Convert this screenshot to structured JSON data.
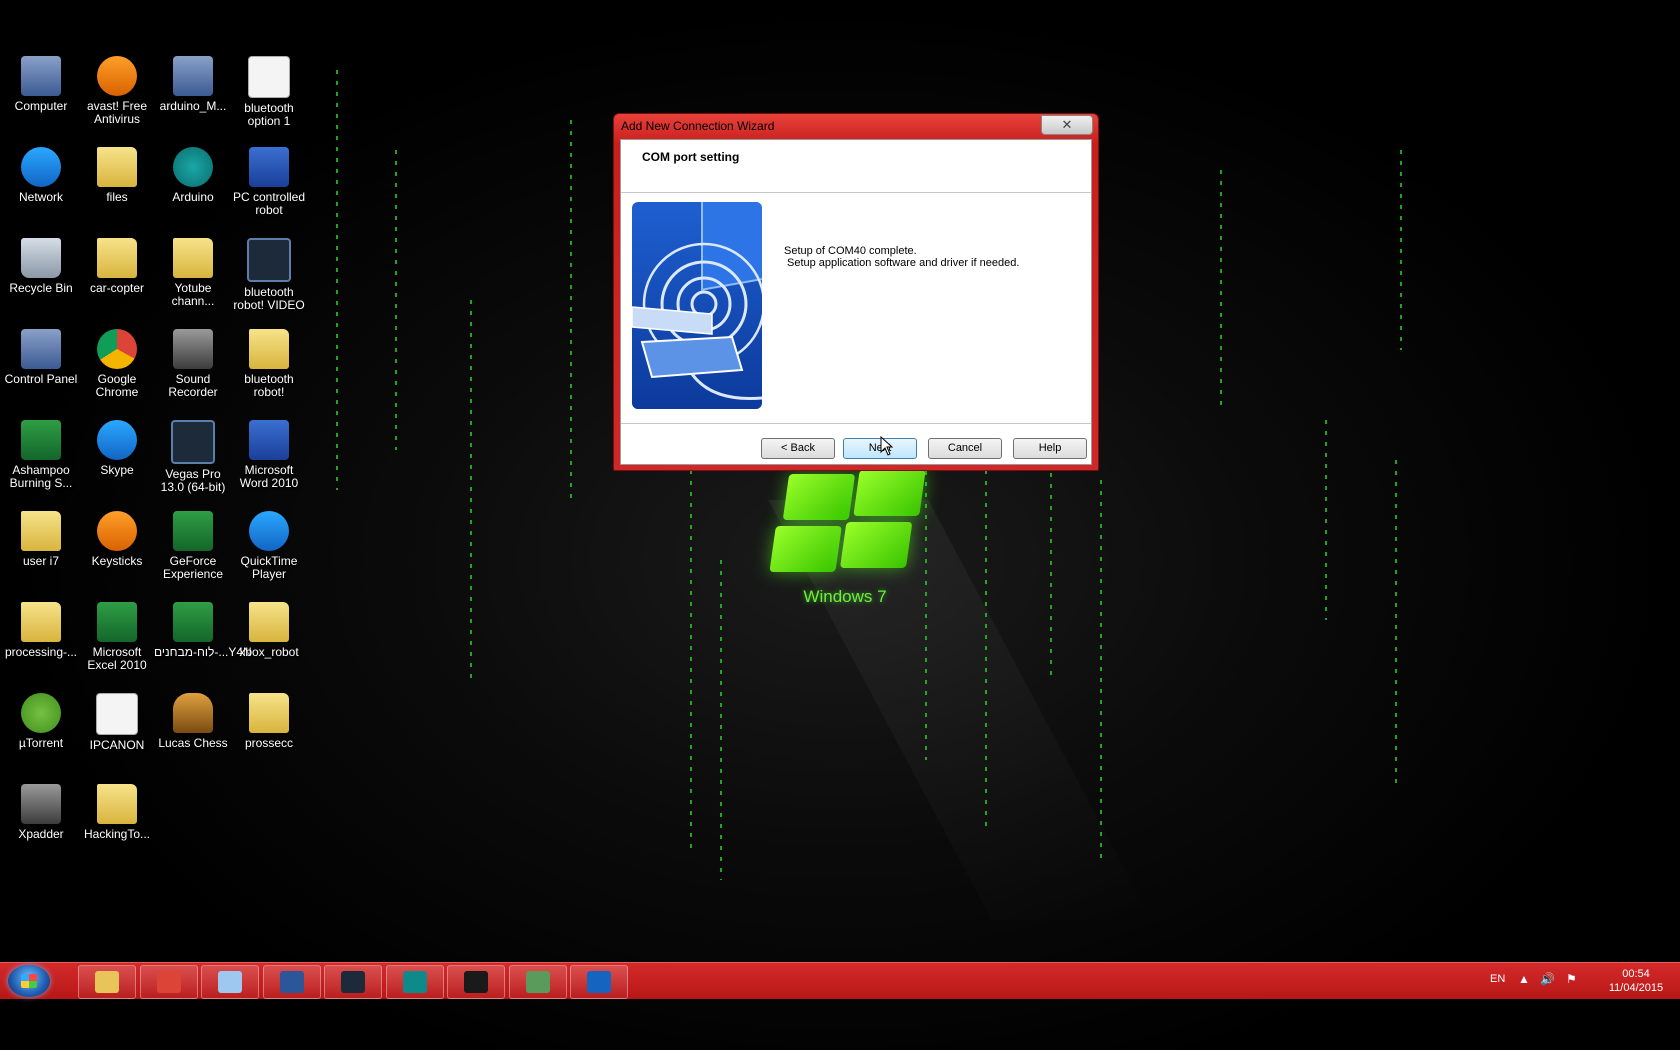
{
  "desktop": {
    "logo_text": "Windows 7",
    "icons": [
      {
        "label": "Computer",
        "icon": "computer-icon",
        "type": "exe"
      },
      {
        "label": "avast! Free Antivirus",
        "icon": "avast-icon",
        "type": "orange"
      },
      {
        "label": "arduino_M...",
        "icon": "winrar-archive-icon",
        "type": "exe"
      },
      {
        "label": "bluetooth option 1",
        "icon": "document-icon",
        "type": "doc"
      },
      {
        "label": "Network",
        "icon": "network-icon",
        "type": "blue"
      },
      {
        "label": "files",
        "icon": "folder-icon",
        "type": "folder"
      },
      {
        "label": "Arduino",
        "icon": "arduino-icon",
        "type": "green"
      },
      {
        "label": "PC controlled robot",
        "icon": "word-document-icon",
        "type": "word"
      },
      {
        "label": "Recycle Bin",
        "icon": "recycle-bin-icon",
        "type": "bin"
      },
      {
        "label": "car-copter",
        "icon": "folder-icon",
        "type": "folder"
      },
      {
        "label": "Yotube chann...",
        "icon": "folder-icon",
        "type": "folder"
      },
      {
        "label": "bluetooth robot! VIDEO",
        "icon": "video-file-icon",
        "type": "video"
      },
      {
        "label": "Control Panel",
        "icon": "control-panel-icon",
        "type": "exe"
      },
      {
        "label": "Google Chrome",
        "icon": "chrome-icon",
        "type": "chrome"
      },
      {
        "label": "Sound Recorder",
        "icon": "microphone-icon",
        "type": "gray"
      },
      {
        "label": "bluetooth robot!",
        "icon": "folder-icon",
        "type": "folder"
      },
      {
        "label": "Ashampoo Burning S...",
        "icon": "ashampoo-icon",
        "type": "excel"
      },
      {
        "label": "Skype",
        "icon": "skype-icon",
        "type": "blue"
      },
      {
        "label": "Vegas Pro 13.0 (64-bit)",
        "icon": "vegas-pro-icon",
        "type": "video"
      },
      {
        "label": "Microsoft Word 2010",
        "icon": "word-icon",
        "type": "word"
      },
      {
        "label": "user i7",
        "icon": "user-folder-icon",
        "type": "folder"
      },
      {
        "label": "Keysticks",
        "icon": "keysticks-icon",
        "type": "orange"
      },
      {
        "label": "GeForce Experience",
        "icon": "geforce-icon",
        "type": "excel"
      },
      {
        "label": "QuickTime Player",
        "icon": "quicktime-icon",
        "type": "blue"
      },
      {
        "label": "processing-...",
        "icon": "folder-icon",
        "type": "folder"
      },
      {
        "label": "Microsoft Excel 2010",
        "icon": "excel-icon",
        "type": "excel"
      },
      {
        "label": "לוח-מבחנים-...Y4N",
        "icon": "excel-document-icon",
        "type": "excel"
      },
      {
        "label": "xbox_robot",
        "icon": "folder-icon",
        "type": "folder"
      },
      {
        "label": "µTorrent",
        "icon": "utorrent-icon",
        "type": "utorrent"
      },
      {
        "label": "IPCANON",
        "icon": "text-file-icon",
        "type": "doc"
      },
      {
        "label": "Lucas Chess",
        "icon": "chess-pawn-icon",
        "type": "chess"
      },
      {
        "label": "prossecc",
        "icon": "folder-icon",
        "type": "folder"
      },
      {
        "label": "Xpadder",
        "icon": "gamepad-icon",
        "type": "gray"
      },
      {
        "label": "HackingTo...",
        "icon": "folder-icon",
        "type": "folder"
      }
    ]
  },
  "dialog": {
    "title": "Add New Connection Wizard",
    "close_label": "✕",
    "heading": "COM port setting",
    "image_icon": "bluetooth-connection-icon",
    "message_line1": "Setup of COM40 complete.",
    "message_line2": "Setup application software and driver if needed.",
    "buttons": {
      "back": "< Back",
      "next": "Next",
      "cancel": "Cancel",
      "help": "Help"
    }
  },
  "taskbar": {
    "start_icon": "windows-start-icon",
    "apps": [
      {
        "name": "windows-explorer-icon",
        "color": "#e8c45a"
      },
      {
        "name": "chrome-icon",
        "color": "#db4437"
      },
      {
        "name": "virtualbox-icon",
        "color": "#9ec8f0"
      },
      {
        "name": "word-icon",
        "color": "#2b579a"
      },
      {
        "name": "vegas-pro-icon",
        "color": "#1d2a3a"
      },
      {
        "name": "arduino-icon",
        "color": "#0f8a8a"
      },
      {
        "name": "processing-icon",
        "color": "#1a1a1a"
      },
      {
        "name": "app-icon",
        "color": "#5a9a5a"
      },
      {
        "name": "bluetooth-icon",
        "color": "#1565c0"
      }
    ],
    "language": "EN",
    "tray_icons": [
      "show-hidden-icons-icon",
      "volume-icon",
      "action-center-flag-icon"
    ],
    "clock_time": "00:54",
    "clock_date": "11/04/2015"
  }
}
